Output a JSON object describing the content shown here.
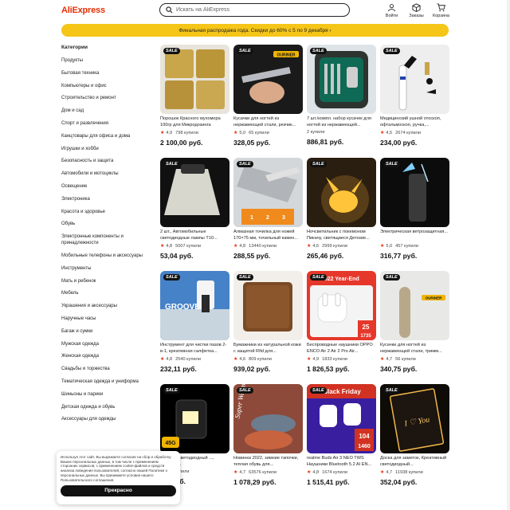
{
  "header": {
    "logo": "AliExpress",
    "search_placeholder": "Искать на AliExpress",
    "icons": [
      {
        "label": "Войти",
        "icon": "user-icon"
      },
      {
        "label": "Заказы",
        "icon": "box-icon"
      },
      {
        "label": "Корзина",
        "icon": "cart-icon"
      }
    ]
  },
  "banner": "Финальная распродажа года. Скидки до 60% с 5 по 9 декабря ›",
  "sidebar": {
    "title": "Категории",
    "items": [
      "Продукты",
      "Бытовая техника",
      "Компьютеры и офис",
      "Строительство и ремонт",
      "Дом и сад",
      "Спорт и развлечения",
      "Канцтовары для офиса и дома",
      "Игрушки и хобби",
      "Безопасность и защита",
      "Автомобили и мотоциклы",
      "Освещение",
      "Электроника",
      "Красота и здоровье",
      "Обувь",
      "Электронные компоненты и принадлежности",
      "Мобильные телефоны и аксессуары",
      "Инструменты",
      "Мать и ребенок",
      "Мебель",
      "Украшения и аксессуары",
      "Наручные часы",
      "Багаж и сумки",
      "Мужская одежда",
      "Женская одежда",
      "Свадьбы и торжества",
      "Тематическая одежда и униформа",
      "Шиньоны и парики",
      "Детская одежда и обувь",
      "Аксессуары для одежды"
    ]
  },
  "sale_badge": "SALE",
  "products": [
    {
      "title": "Порошок Красного мухомора 100гр для Микродозинга",
      "rating": "4,9",
      "sold": "798 купили",
      "price": "2 100,00 руб.",
      "thumb": "powder-bags"
    },
    {
      "title": "Кусачки для ногтей из нержавеющей стали, резчик...",
      "rating": "5,0",
      "sold": "65 купили",
      "price": "328,05 руб.",
      "thumb": "nail-clipper"
    },
    {
      "title": "7 шт./компл. набор кусачек для ногтей из нержавеющей...",
      "rating": "",
      "sold": "2 купили",
      "price": "886,81 руб.",
      "thumb": "manicure-kit"
    },
    {
      "title": "Медицинский ушной отоскоп, офтальмоскоп, ручка,...",
      "rating": "4,5",
      "sold": "2674 купили",
      "price": "234,00 руб.",
      "thumb": "otoscope"
    },
    {
      "title": "2 шт., Автомобильные светодиодные лампы T10...",
      "rating": "4,8",
      "sold": "5007 купили",
      "price": "53,04 руб.",
      "thumb": "led-lamp"
    },
    {
      "title": "Алмазная точилка для ножей 170×75 мм, точильный камен...",
      "rating": "4,8",
      "sold": "13440 купили",
      "price": "288,55 руб.",
      "thumb": "sharpener"
    },
    {
      "title": "Ночсветильник с покемоном Пикачу, светящиеся Детские...",
      "rating": "4,6",
      "sold": "2999 купили",
      "price": "265,46 руб.",
      "thumb": "pikachu"
    },
    {
      "title": "Электрическая ветрозащитная...",
      "rating": "5,0",
      "sold": "457 купили",
      "price": "316,77 руб.",
      "thumb": "lighter"
    },
    {
      "title": "Инструмент для чистки пазов 2-в-1, креативная салфетка...",
      "rating": "4,8",
      "sold": "2540 купили",
      "price": "232,11 руб.",
      "thumb": "groove"
    },
    {
      "title": "Бумажники из натуральной кожи с защитой Rfid для...",
      "rating": "4,6",
      "sold": "809 купили",
      "price": "939,02 руб.",
      "thumb": "wallet"
    },
    {
      "title": "Беспроводные наушники OPPO ENCO Air 2 Air 2 Pro Air...",
      "rating": "4,9",
      "sold": "1833 купили",
      "price": "1 826,53 руб.",
      "thumb": "earbuds"
    },
    {
      "title": "Кусачки для ногтей из нержавеющей стали, тримм...",
      "rating": "4,7",
      "sold": "56 купили",
      "price": "340,75 руб.",
      "thumb": "clipper-gold"
    },
    {
      "title": "...орный светодиодный ..., рабочий...",
      "rating": "",
      "sold": "...2704 купили",
      "price": "...6 руб.",
      "thumb": "portable-light"
    },
    {
      "title": "Новинка 2022, зимние тапочки, теплая обувь для...",
      "rating": "4,7",
      "sold": "63576 купили",
      "price": "1 078,29 руб.",
      "thumb": "slippers"
    },
    {
      "title": "realme Buds Air 3 NEO TWS Наушники Bluetooth 5.2 AI EN...",
      "rating": "4,8",
      "sold": "1674 купили",
      "price": "1 515,41 руб.",
      "thumb": "realme"
    },
    {
      "title": "Доска для заметок, Креативный светодиодный...",
      "rating": "4,7",
      "sold": "11938 купили",
      "price": "352,04 руб.",
      "thumb": "note-board"
    }
  ],
  "thumb_overlays": {
    "ouriner": "OURINER",
    "year_end": "2022 Year-End",
    "black_friday": "Black Friday",
    "groove": "GROOVE",
    "super_warm": "Super Warm",
    "45g": "45G",
    "n104": "104",
    "n1460": "1460",
    "n25": "25",
    "n1735": "1735",
    "i_love_you": "I ♡ You"
  },
  "cookie": {
    "text": "Используя этот сайт, Вы выражаете согласие на сбор и обработку Ваших персональных данных, в том числе с применением сторонних сервисов, с применением cookie-файлов и средств анализа поведения пользователей, согласно нашей Политике о персональных данных. Вы принимаете условия нашего Пользовательского соглашения.",
    "button": "Прекрасно"
  },
  "colors": {
    "brand": "#e62e04",
    "banner": "#f5c518",
    "star": "#e62e04"
  }
}
